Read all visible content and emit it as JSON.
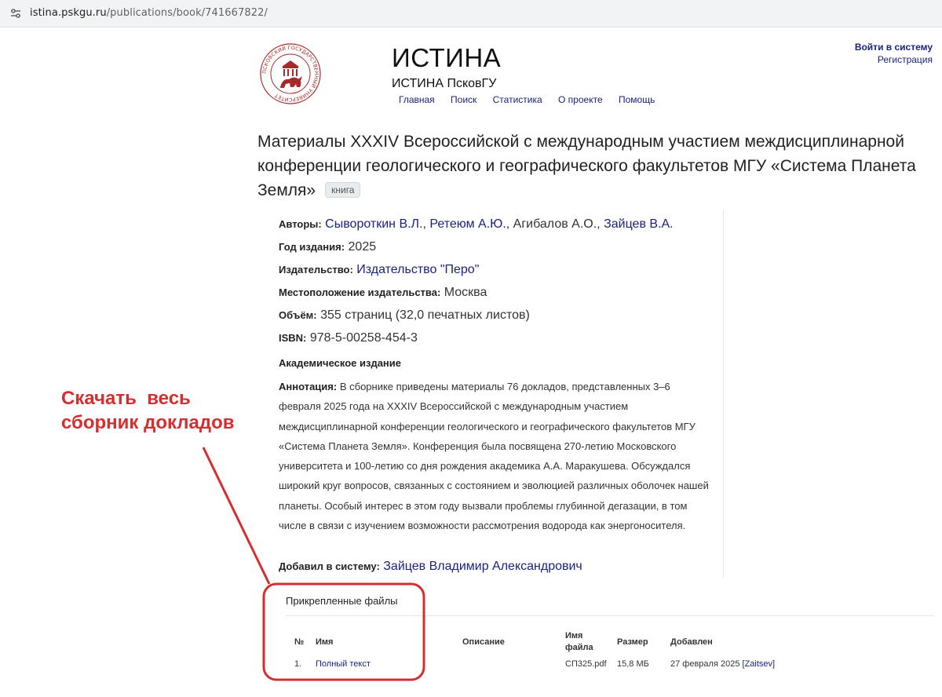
{
  "browser": {
    "url_host": "istina.pskgu.ru",
    "url_path": "/publications/book/741667822/",
    "site_info_icon": "tune-icon"
  },
  "header": {
    "site_title": "ИСТИНА",
    "site_subtitle": "ИСТИНА ПсковГУ",
    "logo_text": "ПСКОВСКИЙ ГОСУДАРСТВЕННЫЙ УНИВЕРСИТЕТ",
    "nav": [
      "Главная",
      "Поиск",
      "Статистика",
      "О проекте",
      "Помощь"
    ],
    "login": "Войти в систему",
    "register": "Регистрация"
  },
  "publication": {
    "title": "Материалы XXXIV Всероссийской с международным участием междисциплинарной конференции геологического и географического факультетов МГУ «Система Планета Земля»",
    "type_badge": "книга",
    "authors_label": "Авторы:",
    "authors": [
      {
        "name": "Сывороткин В.Л.",
        "linked": true
      },
      {
        "name": "Ретеюм А.Ю.",
        "linked": true
      },
      {
        "name": "Агибалов А.О.",
        "linked": false
      },
      {
        "name": "Зайцев В.А.",
        "linked": true
      }
    ],
    "year_label": "Год издания:",
    "year": "2025",
    "publisher_label": "Издательство:",
    "publisher": "Издательство \"Перо\"",
    "location_label": "Местоположение издательства:",
    "location": "Москва",
    "volume_label": "Объём:",
    "volume": "355 страниц (32,0 печатных листов)",
    "isbn_label": "ISBN:",
    "isbn": "978-5-00258-454-3",
    "academic": "Академическое издание",
    "annotation_label": "Аннотация:",
    "annotation": "В сборнике приведены материалы 76 докладов, представленных 3–6 февраля 2025 года на XXXIV Всероссийской с международным участием междисциплинарной конференции геологического и географического факультетов МГУ «Система Планета Земля». Конференция была посвящена 270-летию Московского университета и 100-летию со дня рождения академика А.А. Маракушева. Обсуждался широкий круг вопросов, связанных с состоянием и эволюцией различных оболочек нашей планеты. Особый интерес в этом году вызвали проблемы глубинной дегазации, в том числе в связи с изучением возможности рассмотрения водорода как энергоносителя.",
    "added_by_label": "Добавил в систему:",
    "added_by": "Зайцев Владимир Александрович"
  },
  "files": {
    "title": "Прикрепленные файлы",
    "headers": {
      "num": "№",
      "name": "Имя",
      "description": "Описание",
      "filename": "Имя файла",
      "size": "Размер",
      "added": "Добавлен"
    },
    "rows": [
      {
        "num": "1.",
        "name": "Полный текст",
        "description": "",
        "filename": "СП325.pdf",
        "size": "15,8 МБ",
        "added_date": "27 февраля 2025",
        "added_user": "[Zaitsev]"
      }
    ]
  },
  "callout": {
    "text": "Скачать  весь\nсборник докладов",
    "color": "#d32f2f"
  }
}
